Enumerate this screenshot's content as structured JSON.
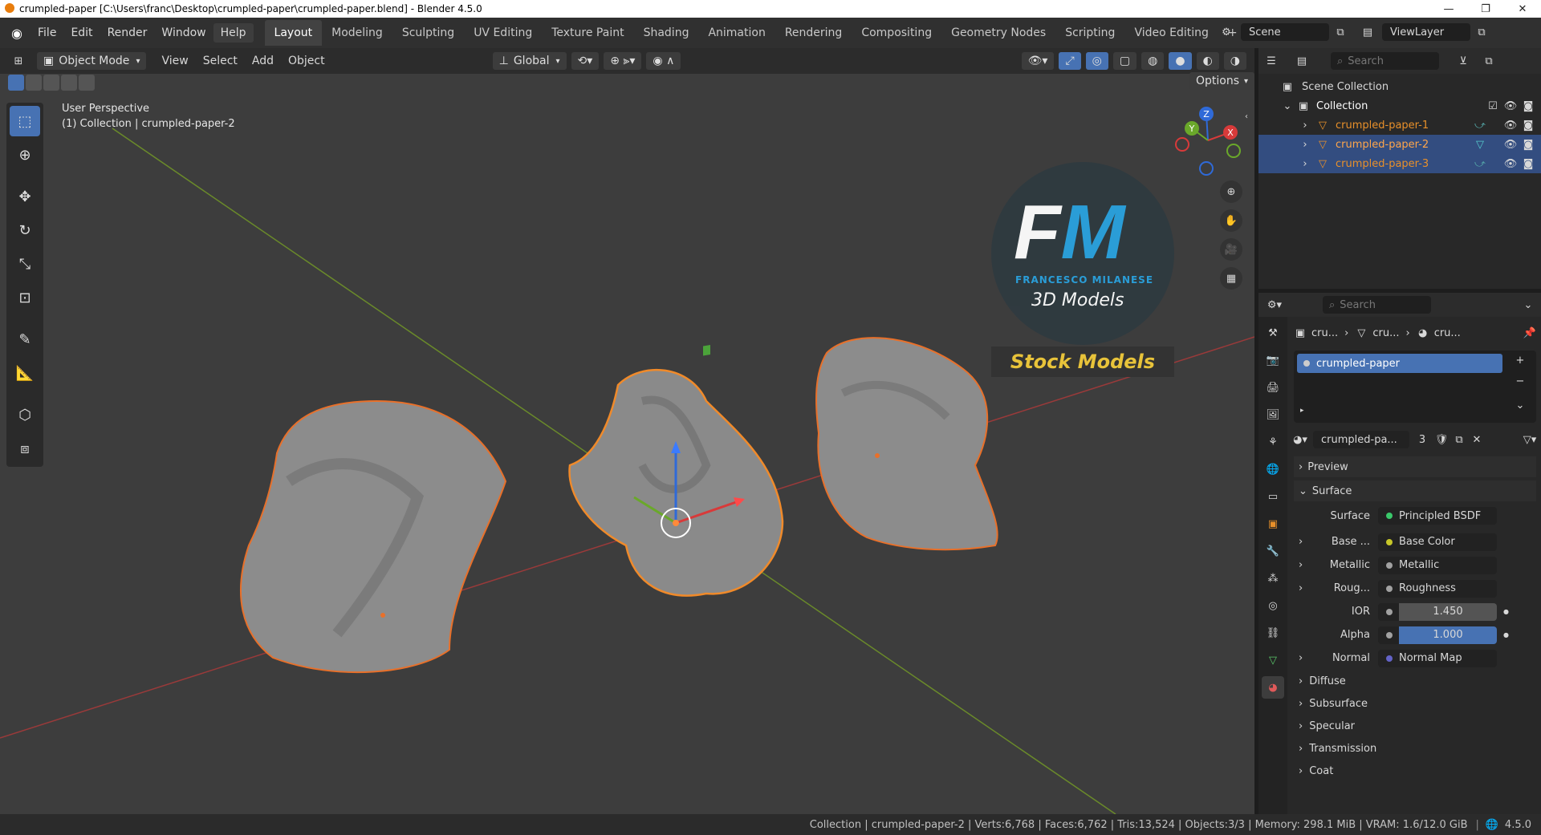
{
  "window": {
    "title": "crumpled-paper [C:\\Users\\franc\\Desktop\\crumpled-paper\\crumpled-paper.blend] - Blender 4.5.0"
  },
  "menu": [
    "File",
    "Edit",
    "Render",
    "Window",
    "Help"
  ],
  "workspaces": [
    "Layout",
    "Modeling",
    "Sculpting",
    "UV Editing",
    "Texture Paint",
    "Shading",
    "Animation",
    "Rendering",
    "Compositing",
    "Geometry Nodes",
    "Scripting",
    "Video Editing"
  ],
  "scene": {
    "label": "Scene",
    "view_layer": "ViewLayer"
  },
  "viewport": {
    "mode": "Object Mode",
    "menus": [
      "View",
      "Select",
      "Add",
      "Object"
    ],
    "orientation": "Global",
    "options": "Options",
    "perspective": "User Perspective",
    "context": "(1) Collection | crumpled-paper-2",
    "watermark": {
      "initials_1": "F",
      "initials_2": "M",
      "name": "FRANCESCO MILANESE",
      "sub": "3D Models",
      "banner": "Stock Models"
    },
    "gizmo": {
      "z": "Z",
      "y": "Y",
      "x": "X"
    }
  },
  "outliner": {
    "search_placeholder": "Search",
    "scene_collection": "Scene Collection",
    "collection": "Collection",
    "items": [
      "crumpled-paper-1",
      "crumpled-paper-2",
      "crumpled-paper-3"
    ]
  },
  "properties": {
    "search_placeholder": "Search",
    "breadcrumb": [
      "cru...",
      "cru...",
      "cru..."
    ],
    "material_slot": "crumpled-paper",
    "material_name": "crumpled-pa...",
    "users": "3",
    "panels": {
      "preview": "Preview",
      "surface": "Surface"
    },
    "surface_label": "Surface",
    "surface_value": "Principled BSDF",
    "inputs": [
      {
        "label": "Base ...",
        "value": "Base Color",
        "color": "#c7c729"
      },
      {
        "label": "Metallic",
        "value": "Metallic",
        "color": "#a1a1a1"
      },
      {
        "label": "Roug...",
        "value": "Roughness",
        "color": "#a1a1a1"
      },
      {
        "label": "IOR",
        "value": "1.450",
        "color": "#a1a1a1"
      },
      {
        "label": "Alpha",
        "value": "1.000",
        "color": "#a1a1a1"
      },
      {
        "label": "Normal",
        "value": "Normal Map",
        "color": "#6363c7"
      }
    ],
    "subpanels": [
      "Diffuse",
      "Subsurface",
      "Specular",
      "Transmission",
      "Coat"
    ]
  },
  "status": {
    "text": "Collection | crumpled-paper-2 | Verts:6,768 | Faces:6,762 | Tris:13,524 | Objects:3/3 | Memory: 298.1 MiB | VRAM: 1.6/12.0 GiB",
    "version": "4.5.0"
  }
}
